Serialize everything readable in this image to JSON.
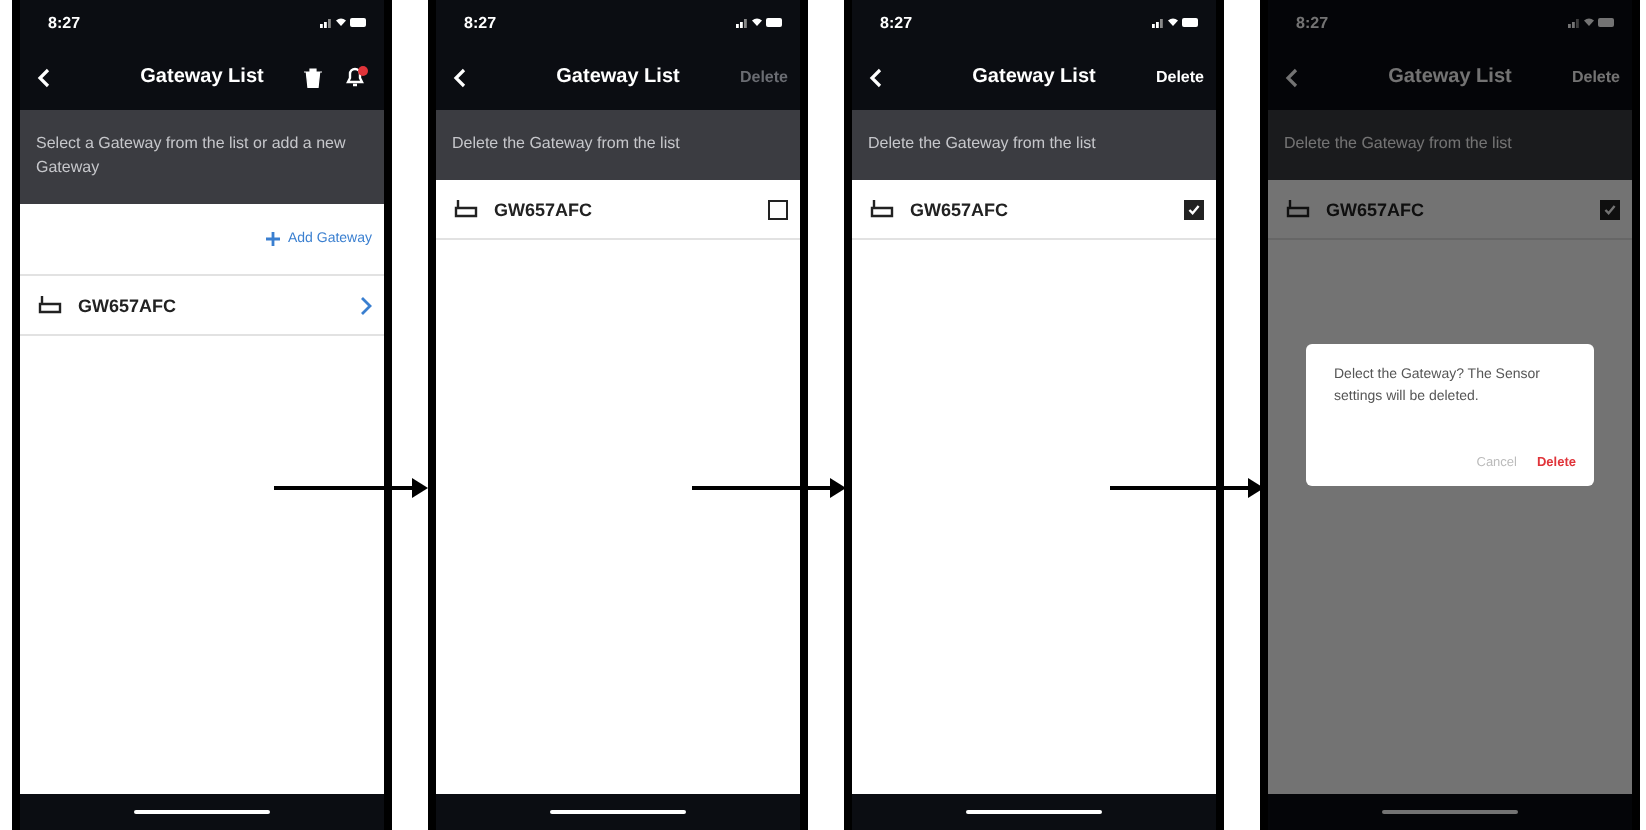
{
  "screens": [
    {
      "kind": "browse",
      "time": "8:27",
      "title": "Gateway List",
      "notification_badge": true,
      "banner": "Select a Gateway from the list or add a new Gateway",
      "add_link": "Add Gateway",
      "rows": [
        {
          "name": "GW657AFC",
          "kind": "link"
        }
      ]
    },
    {
      "kind": "delete",
      "time": "8:27",
      "title": "Gateway List",
      "delete_action": {
        "label": "Delete",
        "disabled": true
      },
      "banner": "Delete the Gateway from the list",
      "rows": [
        {
          "name": "GW657AFC",
          "kind": "checkbox",
          "checked": false
        }
      ]
    },
    {
      "kind": "delete",
      "time": "8:27",
      "title": "Gateway List",
      "delete_action": {
        "label": "Delete",
        "disabled": false
      },
      "banner": "Delete the Gateway from the list",
      "rows": [
        {
          "name": "GW657AFC",
          "kind": "checkbox",
          "checked": true
        }
      ]
    },
    {
      "kind": "delete",
      "time": "8:27",
      "title": "Gateway List",
      "delete_action": {
        "label": "Delete",
        "disabled": false
      },
      "banner": "Delete the Gateway from the list",
      "rows": [
        {
          "name": "GW657AFC",
          "kind": "checkbox",
          "checked": true
        }
      ],
      "dialog": {
        "message": "Delect the Gateway? The Sensor settings will be deleted.",
        "cancel": "Cancel",
        "confirm": "Delete"
      }
    }
  ]
}
